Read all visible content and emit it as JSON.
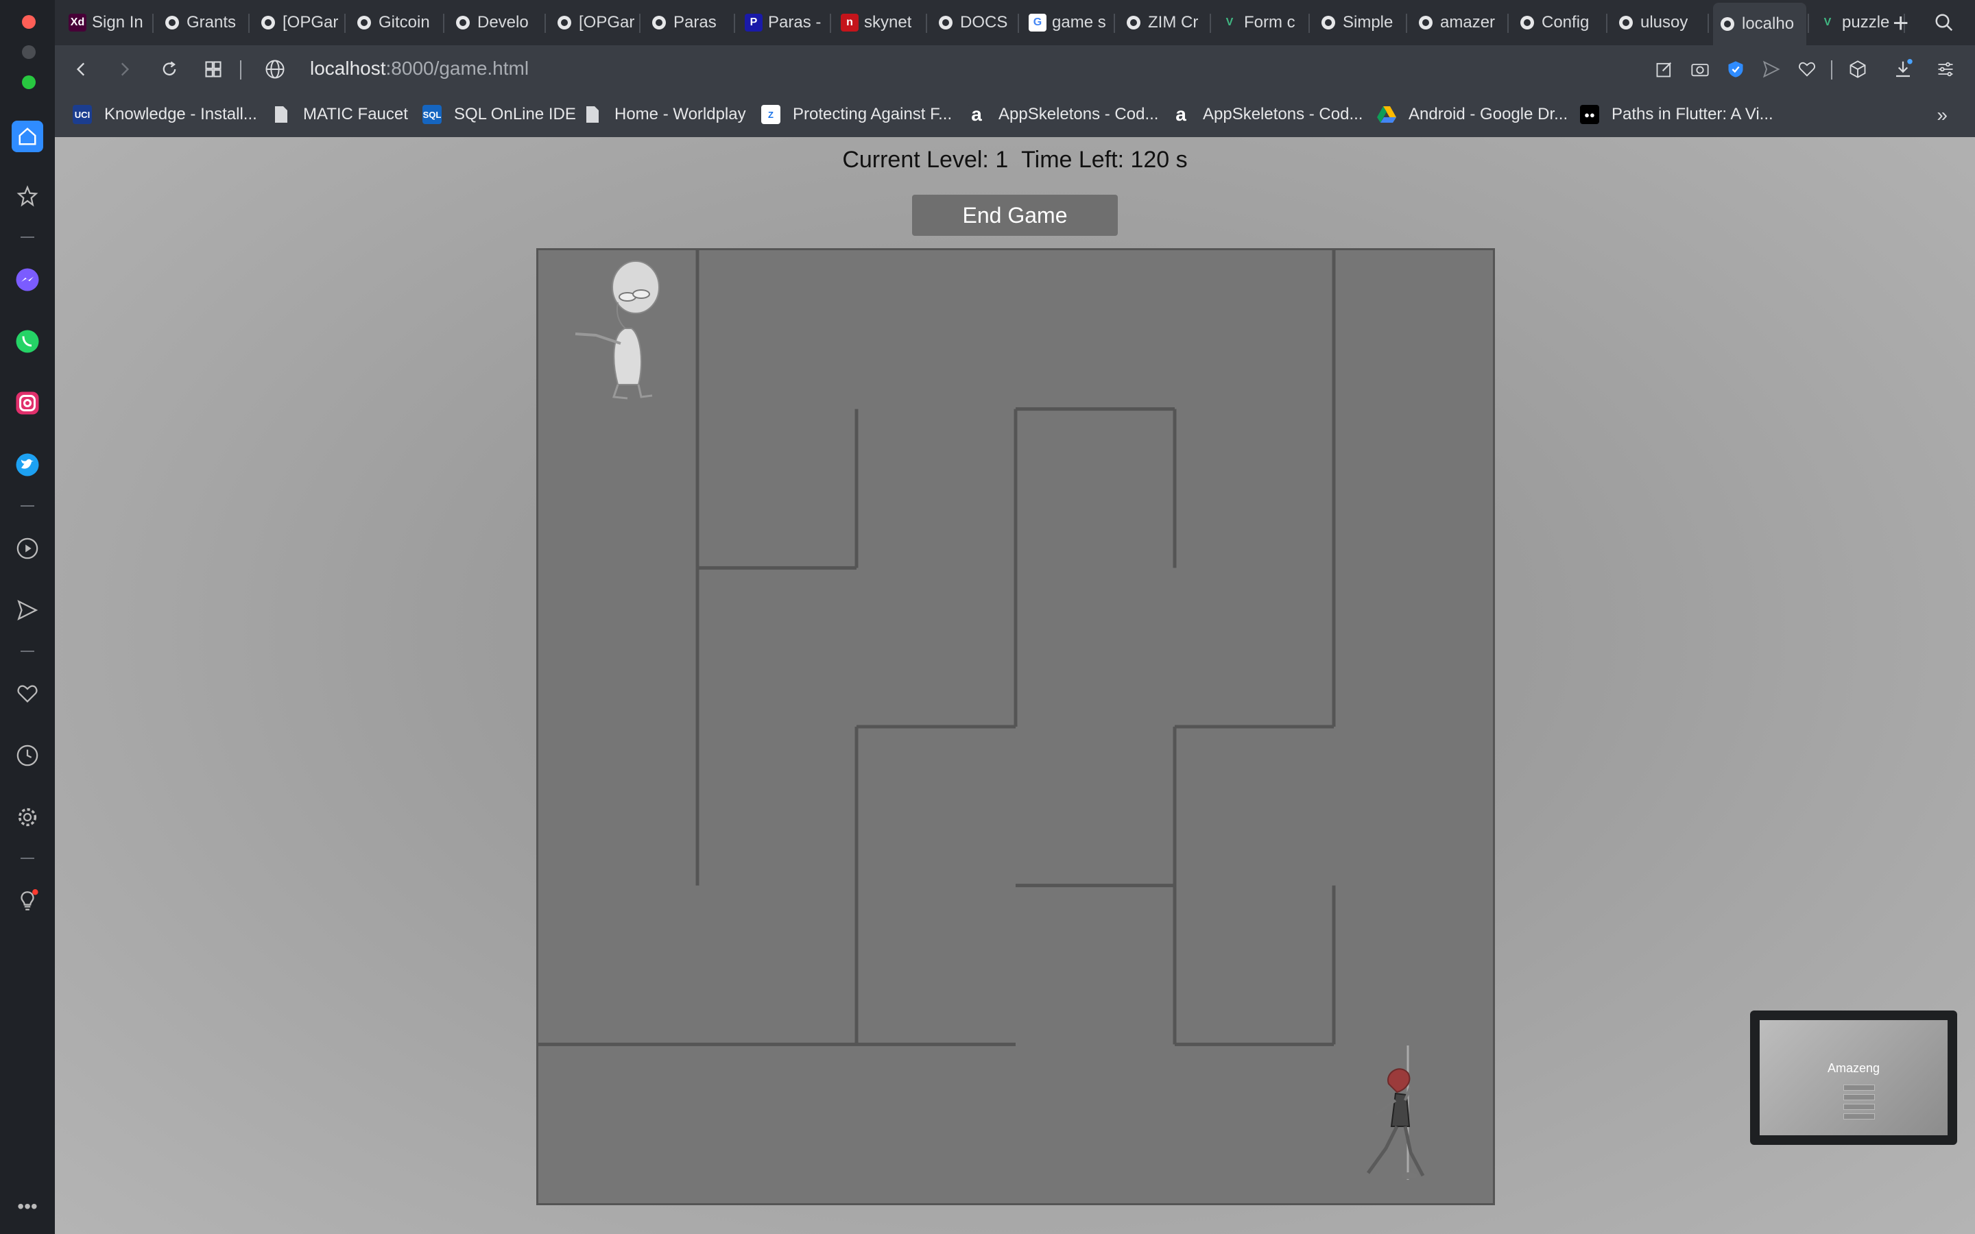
{
  "tabs": [
    {
      "label": "Sign In",
      "icon": "adobe-xd-icon",
      "badge": "Xd",
      "color": "#470137"
    },
    {
      "label": "Grants",
      "icon": "gitcoin-icon"
    },
    {
      "label": "[OPGar",
      "icon": "gitcoin-icon"
    },
    {
      "label": "Gitcoin",
      "icon": "gitcoin-icon"
    },
    {
      "label": "Develo",
      "icon": "github-icon"
    },
    {
      "label": "[OPGar",
      "icon": "gitcoin-icon"
    },
    {
      "label": "Paras",
      "icon": "github-icon"
    },
    {
      "label": "Paras -",
      "icon": "paras-icon",
      "badge": "P",
      "color": "#1a1aa8"
    },
    {
      "label": "skynet",
      "icon": "skynet-icon",
      "badge": "n",
      "color": "#c4141b"
    },
    {
      "label": "DOCS",
      "icon": "docs-icon"
    },
    {
      "label": "game s",
      "icon": "google-icon",
      "badge": "G",
      "color": "#ffffff"
    },
    {
      "label": "ZIM Cr",
      "icon": "codepen-icon"
    },
    {
      "label": "Form c",
      "icon": "vite-icon",
      "badge": "V",
      "color": "#3a3e45"
    },
    {
      "label": "Simple",
      "icon": "codepen-icon"
    },
    {
      "label": "amazer",
      "icon": "github-icon"
    },
    {
      "label": "Config",
      "icon": "firebase-icon"
    },
    {
      "label": "ulusoy",
      "icon": "github-icon"
    },
    {
      "label": "localho",
      "icon": "page-icon",
      "active": true
    },
    {
      "label": "puzzle",
      "icon": "vue-icon",
      "badge": "V",
      "color": "#3a3e45"
    }
  ],
  "address": {
    "host": "localhost",
    "path": ":8000/game.html"
  },
  "bookmarks": [
    {
      "label": "Knowledge - Install...",
      "icon": "uci-icon",
      "badge": "UCI",
      "color": "#1b3d8f"
    },
    {
      "label": "MATIC Faucet",
      "icon": "page-icon"
    },
    {
      "label": "SQL OnLine IDE",
      "icon": "sql-icon",
      "badge": "SQL",
      "color": "#1565c0"
    },
    {
      "label": "Home - Worldplay",
      "icon": "page-icon"
    },
    {
      "label": "Protecting Against F...",
      "icon": "z-icon",
      "badge": "Z",
      "color": "#ffffff"
    },
    {
      "label": "AppSkeletons - Cod...",
      "icon": "appskeletons-icon",
      "badge": "a",
      "color": "#3a3e45"
    },
    {
      "label": "AppSkeletons - Cod...",
      "icon": "appskeletons-icon",
      "badge": "a",
      "color": "#3a3e45"
    },
    {
      "label": "Android - Google Dr...",
      "icon": "google-drive-icon"
    },
    {
      "label": "Paths in Flutter: A Vi...",
      "icon": "medium-icon",
      "badge": "●●",
      "color": "#000000"
    }
  ],
  "game": {
    "level_label": "Current Level: 1",
    "time_label": "Time Left: 120 s",
    "end_button": "End Game",
    "grid": {
      "cols": 6,
      "rows": 6
    },
    "walls": [
      [
        1,
        0,
        1,
        2
      ],
      [
        1,
        2,
        2,
        2
      ],
      [
        2,
        1,
        2,
        2
      ],
      [
        3,
        1,
        4,
        1
      ],
      [
        3,
        1,
        3,
        3
      ],
      [
        4,
        1,
        4,
        2
      ],
      [
        5,
        0,
        5,
        3
      ],
      [
        1,
        2,
        1,
        4
      ],
      [
        2,
        3,
        2,
        5
      ],
      [
        2,
        3,
        3,
        3
      ],
      [
        4,
        3,
        5,
        3
      ],
      [
        4,
        3,
        4,
        5
      ],
      [
        3,
        4,
        4,
        4
      ],
      [
        0,
        5,
        3,
        5
      ],
      [
        4,
        5,
        5,
        5
      ],
      [
        5,
        4,
        5,
        5
      ]
    ],
    "player": "alien-character",
    "goal": "girl-character"
  },
  "thumbnail": {
    "title": "Amazeng"
  },
  "colors": {
    "wall": "#555555",
    "maze_bg": "#767676",
    "button": "#6f6f6f"
  }
}
